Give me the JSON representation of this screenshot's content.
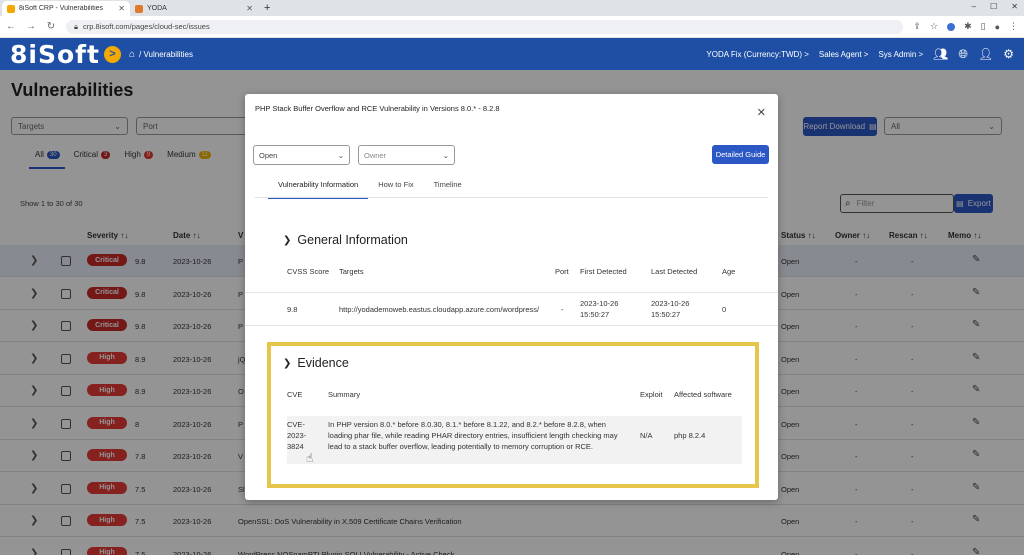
{
  "browser": {
    "tabs": [
      {
        "title": "8iSoft CRP - Vulnerabilities",
        "active": true,
        "favicon_color": "#f2a900"
      },
      {
        "title": "YODA",
        "active": false,
        "favicon_color": "#e07a2a"
      }
    ],
    "new_tab": "+",
    "url": "crp.8isoft.com/pages/cloud-sec/issues",
    "win_min": "–",
    "win_max": "☐",
    "win_close": "✕"
  },
  "header": {
    "logo": "8iSoft",
    "logo_btn": ">",
    "breadcrumb": "/ Vulnerabilities",
    "menu": [
      "YODA Fix (Currency:TWD) >",
      "Sales Agent >",
      "Sys Admin >"
    ]
  },
  "page": {
    "title": "Vulnerabilities",
    "filters": {
      "targets": "Targets",
      "port": "Port",
      "all": "All"
    },
    "report_download": "Report Download",
    "tabs": [
      {
        "label": "All",
        "count": "30",
        "color": "#2c58c5"
      },
      {
        "label": "Critical",
        "count": "3",
        "color": "#c62828"
      },
      {
        "label": "High",
        "count": "9",
        "color": "#e53935"
      },
      {
        "label": "Medium",
        "count": "11",
        "color": "#f2b600"
      }
    ],
    "show_text": "Show 1 to 30 of 30",
    "filter_placeholder": "Filter",
    "export": "Export",
    "columns": {
      "severity": "Severity ↑↓",
      "date": "Date ↑↓",
      "v": "V",
      "status": "Status ↑↓",
      "owner": "Owner ↑↓",
      "rescan": "Rescan ↑↓",
      "memo": "Memo ↑↓"
    },
    "rows": [
      {
        "severity": "Critical",
        "score": "9.8",
        "date": "2023-10-26",
        "name": "P",
        "status": "Open",
        "owner": "-",
        "rescan": "-"
      },
      {
        "severity": "Critical",
        "score": "9.8",
        "date": "2023-10-26",
        "name": "P",
        "status": "Open",
        "owner": "-",
        "rescan": "-"
      },
      {
        "severity": "Critical",
        "score": "9.8",
        "date": "2023-10-26",
        "name": "P",
        "status": "Open",
        "owner": "-",
        "rescan": "-"
      },
      {
        "severity": "High",
        "score": "8.9",
        "date": "2023-10-26",
        "name": "jQ",
        "status": "Open",
        "owner": "-",
        "rescan": "-"
      },
      {
        "severity": "High",
        "score": "8.9",
        "date": "2023-10-26",
        "name": "O",
        "status": "Open",
        "owner": "-",
        "rescan": "-"
      },
      {
        "severity": "High",
        "score": "8",
        "date": "2023-10-26",
        "name": "P",
        "status": "Open",
        "owner": "-",
        "rescan": "-"
      },
      {
        "severity": "High",
        "score": "7.8",
        "date": "2023-10-26",
        "name": "V",
        "status": "Open",
        "owner": "-",
        "rescan": "-"
      },
      {
        "severity": "High",
        "score": "7.5",
        "date": "2023-10-26",
        "name": "Sl",
        "status": "Open",
        "owner": "-",
        "rescan": "-"
      },
      {
        "severity": "High",
        "score": "7.5",
        "date": "2023-10-26",
        "name": "OpenSSL: DoS Vulnerability in X.509 Certificate Chains Verification",
        "status": "Open",
        "owner": "-",
        "rescan": "-"
      },
      {
        "severity": "High",
        "score": "7.5",
        "date": "2023-10-26",
        "name": "WordPress NOSpamPTI Plugin SQLI Vulnerability - Active Check",
        "status": "Open",
        "owner": "-",
        "rescan": "-"
      }
    ]
  },
  "modal": {
    "title": "PHP Stack Buffer Overflow and RCE Vulnerability in Versions 8.0.* - 8.2.8",
    "close": "✕",
    "status_select": "Open",
    "owner_select": "Owner",
    "detailed_guide": "Detailed Guide",
    "tabs": [
      "Vulnerability Information",
      "How to Fix",
      "Timeline"
    ],
    "general": {
      "title": "General Information",
      "headers": {
        "cvss": "CVSS Score",
        "targets": "Targets",
        "port": "Port",
        "first": "First Detected",
        "last": "Last Detected",
        "age": "Age"
      },
      "row": {
        "cvss": "9.8",
        "target": "http://yodademoweb.eastus.cloudapp.azure.com/wordpress/",
        "port": "-",
        "first_date": "2023-10-26",
        "first_time": "15:50:27",
        "last_date": "2023-10-26",
        "last_time": "15:50:27",
        "age": "0"
      }
    },
    "evidence": {
      "title": "Evidence",
      "headers": {
        "cve": "CVE",
        "summary": "Summary",
        "exploit": "Exploit",
        "software": "Affected software"
      },
      "row": {
        "cve_1": "CVE-",
        "cve_2": "2023-",
        "cve_3": "3824",
        "summary_1": "In PHP version 8.0.* before 8.0.30,  8.1.* before 8.1.22, and 8.2.* before 8.2.8, when",
        "summary_2": "loading phar file, while reading PHAR directory entries, insufficient length checking may",
        "summary_3": "lead to a stack buffer overflow, leading potentially to memory corruption or RCE.",
        "exploit": "N/A",
        "software": "php 8.2.4"
      }
    }
  }
}
